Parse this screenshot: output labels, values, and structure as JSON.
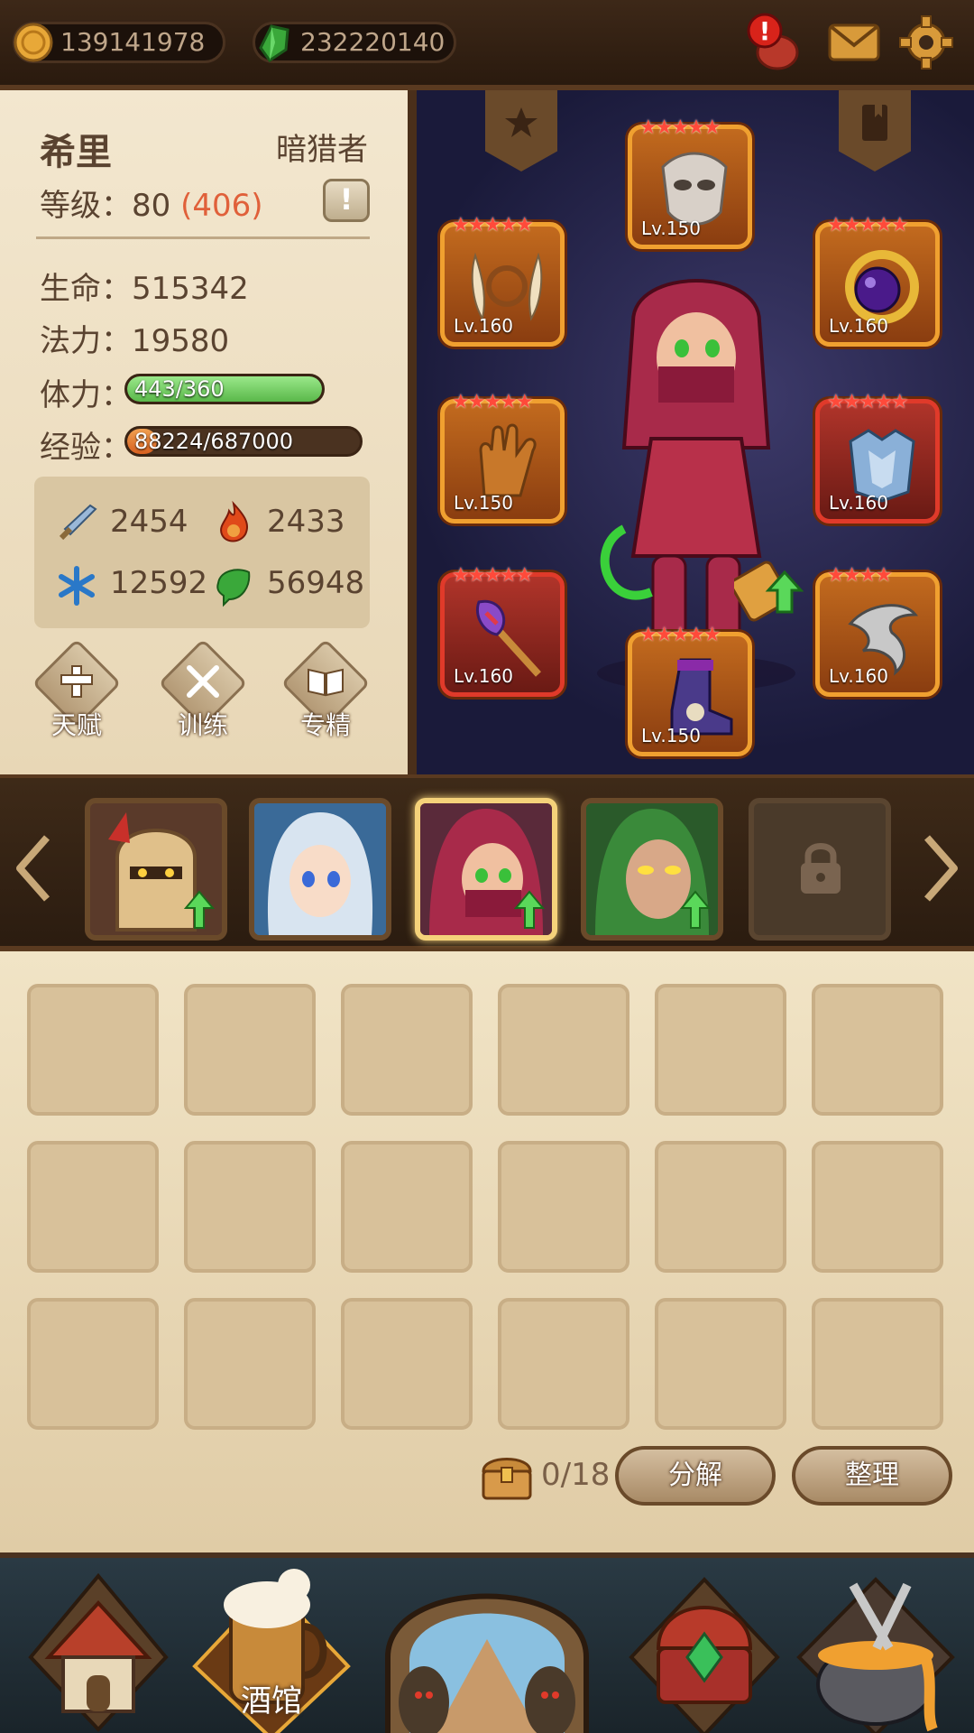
{
  "currency": {
    "gold": "139141978",
    "gems": "232220140"
  },
  "hero": {
    "name": "希里",
    "class": "暗猎者",
    "level_label": "等级：",
    "level": "80",
    "level_bonus": "(406)",
    "hp_label": "生命：",
    "hp": "515342",
    "mp_label": "法力：",
    "mp": "19580",
    "stamina_label": "体力：",
    "stamina": "443/360",
    "stamina_fill": 1.0,
    "exp_label": "经验：",
    "exp": "88224/687000",
    "exp_fill": 0.128,
    "stats": {
      "attack": "2454",
      "fire": "2433",
      "frost": "12592",
      "nature": "56948"
    },
    "buttons": {
      "talent": "天赋",
      "train": "训练",
      "specialize": "专精"
    }
  },
  "equipment": {
    "mask": "Lv.150",
    "fangs": "Lv.160",
    "orb": "Lv.160",
    "gloves": "Lv.150",
    "armor": "Lv.160",
    "staff": "Lv.160",
    "boots": "Lv.150",
    "blade": "Lv.160"
  },
  "inventory": {
    "count": "0/18",
    "decompose": "分解",
    "sort": "整理"
  },
  "nav": {
    "tavern": "酒馆"
  },
  "colors": {
    "level_bonus": "#e0603a",
    "stamina_bar": "#7ad068",
    "exp_bar": "#e07830"
  }
}
